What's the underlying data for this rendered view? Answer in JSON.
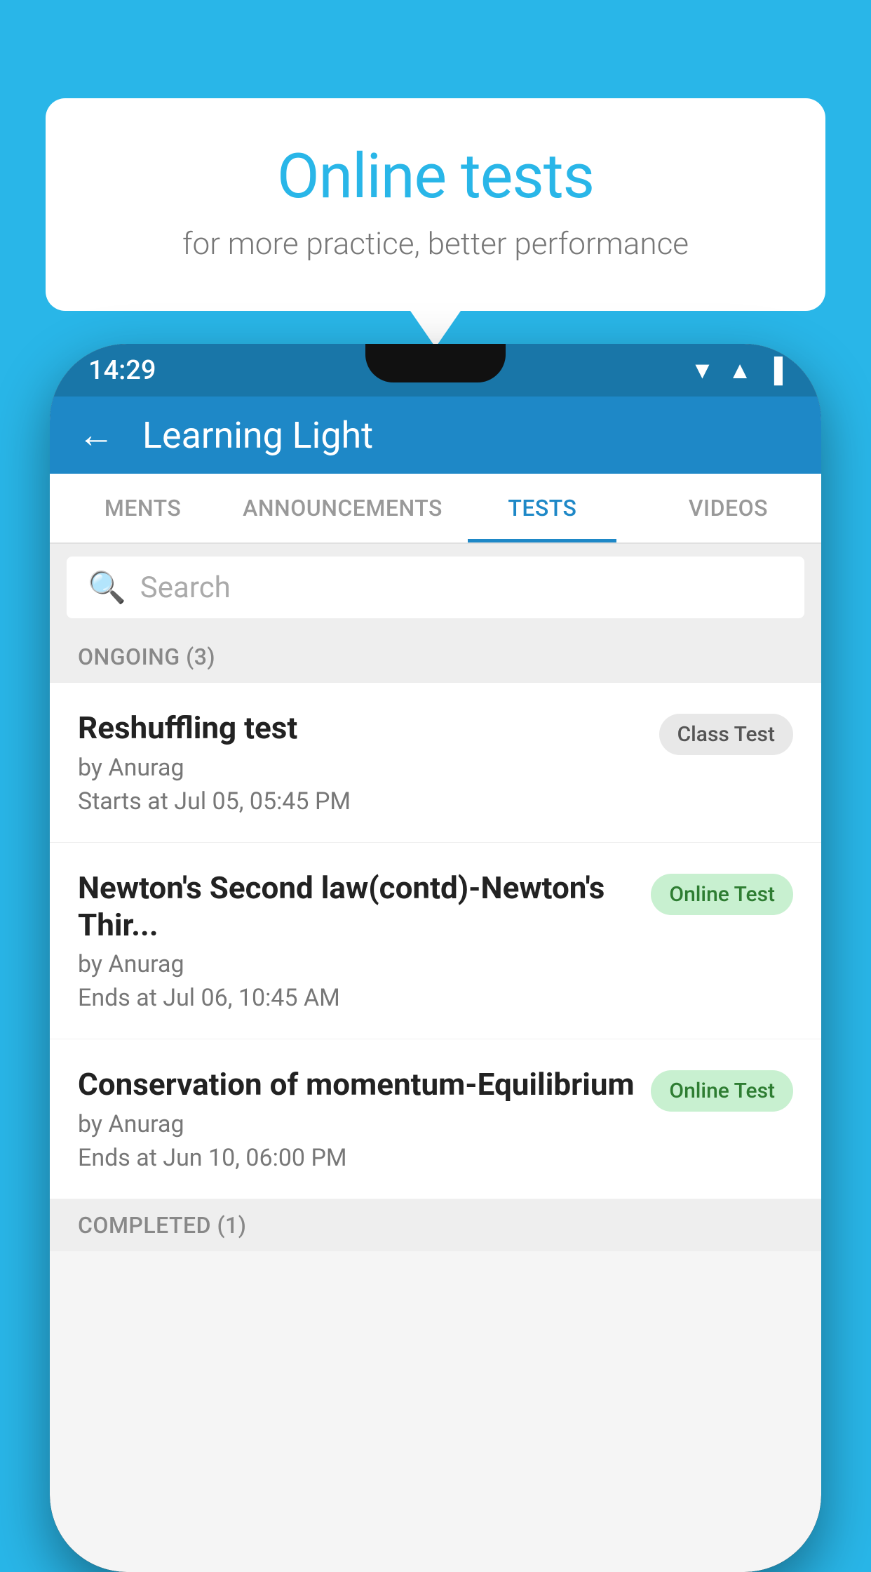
{
  "background_color": "#29b6e8",
  "bubble": {
    "title": "Online tests",
    "subtitle": "for more practice, better performance"
  },
  "status_bar": {
    "time": "14:29",
    "icons": [
      "▼",
      "▲",
      "▐"
    ]
  },
  "app_bar": {
    "back_label": "←",
    "title": "Learning Light"
  },
  "tabs": [
    {
      "label": "MENTS",
      "active": false
    },
    {
      "label": "ANNOUNCEMENTS",
      "active": false
    },
    {
      "label": "TESTS",
      "active": true
    },
    {
      "label": "VIDEOS",
      "active": false
    }
  ],
  "search": {
    "placeholder": "Search",
    "icon": "🔍"
  },
  "ongoing_section": {
    "label": "ONGOING (3)"
  },
  "tests": [
    {
      "name": "Reshuffling test",
      "by": "by Anurag",
      "time": "Starts at  Jul 05, 05:45 PM",
      "badge": "Class Test",
      "badge_type": "class"
    },
    {
      "name": "Newton's Second law(contd)-Newton's Thir...",
      "by": "by Anurag",
      "time": "Ends at  Jul 06, 10:45 AM",
      "badge": "Online Test",
      "badge_type": "online"
    },
    {
      "name": "Conservation of momentum-Equilibrium",
      "by": "by Anurag",
      "time": "Ends at  Jun 10, 06:00 PM",
      "badge": "Online Test",
      "badge_type": "online"
    }
  ],
  "completed_section": {
    "label": "COMPLETED (1)"
  }
}
